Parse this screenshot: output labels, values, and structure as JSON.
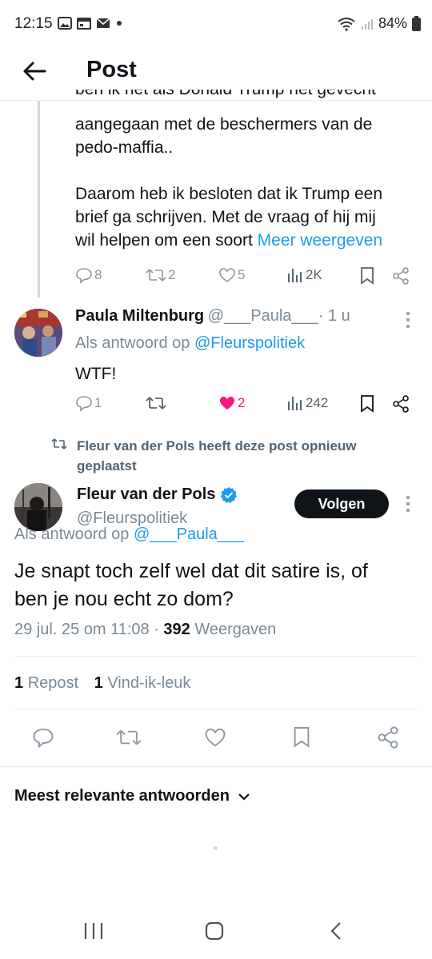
{
  "status_bar": {
    "time": "12:15",
    "notification_icons": [
      "gallery-icon",
      "calendar-icon",
      "mail-icon",
      "dot-icon"
    ],
    "battery": "84%"
  },
  "header": {
    "title": "Post"
  },
  "parent_post": {
    "text_partial_line": "ben ik het als Donald Trump het gevecht",
    "text_lines": [
      "aangegaan met de beschermers van de",
      "pedo-maffia..",
      "",
      "Daarom heb ik besloten dat ik Trump een",
      "brief ga schrijven. Met de vraag of hij mij",
      "wil helpen om een soort"
    ],
    "more_link": "Meer weergeven",
    "replies": "8",
    "reposts": "2",
    "likes": "5",
    "views": "2K"
  },
  "reply_post": {
    "name": "Paula Miltenburg",
    "handle": "@___Paula___",
    "time": "· 1 u",
    "reply_to_prefix": "Als antwoord op",
    "reply_to_handle": "@Fleurspolitiek",
    "text": "WTF!",
    "replies": "1",
    "reposts": "",
    "likes": "2",
    "views": "242"
  },
  "repost_notice": {
    "line1": "Fleur van der Pols heeft deze post opnieuw",
    "line2": "geplaatst"
  },
  "main_post": {
    "name": "Fleur van der Pols",
    "handle": "@Fleurspolitiek",
    "follow_label": "Volgen",
    "reply_to_prefix": "Als antwoord op",
    "reply_to_handle": "@___Paula___",
    "text_line1": "Je snapt toch zelf wel dat dit satire is, of",
    "text_line2": "ben je nou echt zo dom?",
    "timestamp": "29 jul. 25 om 11:08",
    "separator": " · ",
    "views_count": "392",
    "views_label": "Weergaven",
    "reposts_count": "1",
    "reposts_label": "Repost",
    "likes_count": "1",
    "likes_label": "Vind-ik-leuk"
  },
  "replies_section": {
    "sort_label": "Meest relevante antwoorden"
  },
  "colors": {
    "accent": "#1d9bf0",
    "like_active": "#f91880",
    "text": "#0f1419",
    "muted": "#7b8a96"
  }
}
